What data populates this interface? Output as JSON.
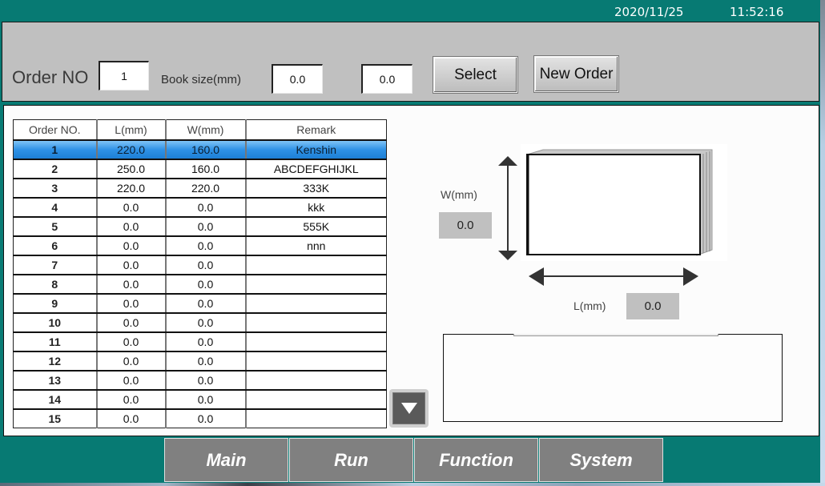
{
  "status_bar": {
    "date": "2020/11/25",
    "time": "11:52:16"
  },
  "header": {
    "order_no_label": "Order NO",
    "order_no_value": "1",
    "book_size_label": "Book size(mm)",
    "book_size_l_value": "0.0",
    "book_size_w_value": "0.0",
    "select_label": "Select",
    "new_order_label": "New Order"
  },
  "table": {
    "columns": [
      "Order NO.",
      "L(mm)",
      "W(mm)",
      "Remark"
    ],
    "selected_row": 0,
    "rows": [
      {
        "no": "1",
        "l": "220.0",
        "w": "160.0",
        "remark": "Kenshin"
      },
      {
        "no": "2",
        "l": "250.0",
        "w": "160.0",
        "remark": "ABCDEFGHIJKL"
      },
      {
        "no": "3",
        "l": "220.0",
        "w": "220.0",
        "remark": "333K"
      },
      {
        "no": "4",
        "l": "0.0",
        "w": "0.0",
        "remark": "kkk"
      },
      {
        "no": "5",
        "l": "0.0",
        "w": "0.0",
        "remark": "555K"
      },
      {
        "no": "6",
        "l": "0.0",
        "w": "0.0",
        "remark": "nnn"
      },
      {
        "no": "7",
        "l": "0.0",
        "w": "0.0",
        "remark": ""
      },
      {
        "no": "8",
        "l": "0.0",
        "w": "0.0",
        "remark": ""
      },
      {
        "no": "9",
        "l": "0.0",
        "w": "0.0",
        "remark": ""
      },
      {
        "no": "10",
        "l": "0.0",
        "w": "0.0",
        "remark": ""
      },
      {
        "no": "11",
        "l": "0.0",
        "w": "0.0",
        "remark": ""
      },
      {
        "no": "12",
        "l": "0.0",
        "w": "0.0",
        "remark": ""
      },
      {
        "no": "13",
        "l": "0.0",
        "w": "0.0",
        "remark": ""
      },
      {
        "no": "14",
        "l": "0.0",
        "w": "0.0",
        "remark": ""
      },
      {
        "no": "15",
        "l": "0.0",
        "w": "0.0",
        "remark": ""
      }
    ],
    "scroll_icon": "triangle-down-icon"
  },
  "dimensions": {
    "w_label": "W(mm)",
    "w_value": "0.0",
    "l_label": "L(mm)",
    "l_value": "0.0"
  },
  "message_box": {
    "text": ""
  },
  "nav": {
    "items": [
      {
        "label": "Main"
      },
      {
        "label": "Run"
      },
      {
        "label": "Function"
      },
      {
        "label": "System"
      }
    ]
  },
  "colors": {
    "frame_teal": "#077a73",
    "panel_gray": "#c0c0c0",
    "selected_row_blue": "#2f92e6",
    "nav_button_gray": "#808080"
  }
}
